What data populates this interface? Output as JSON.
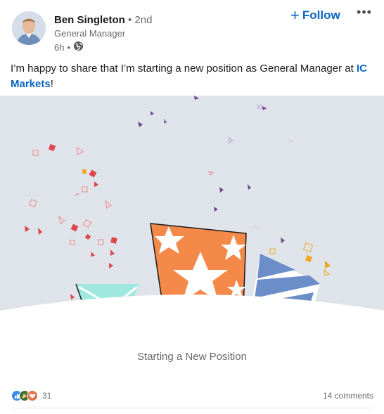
{
  "author": {
    "name": "Ben Singleton",
    "degree": "• 2nd",
    "headline": "General Manager",
    "time": "6h",
    "visibility_icon": "globe-icon"
  },
  "actions": {
    "follow_label": "Follow",
    "more_icon": "more-icon"
  },
  "post": {
    "text_before": "I’m happy to share that I’m starting a new position as General Manager at ",
    "company": "IC Markets",
    "text_after": "!"
  },
  "card": {
    "caption": "Starting a New Position"
  },
  "social": {
    "reaction_count": "31",
    "comments": "14 comments",
    "reaction_icons": [
      "like-icon",
      "celebrate-icon",
      "love-icon"
    ]
  },
  "colors": {
    "brand_blue": "#0a66c2",
    "art_background": "#dfe3ea",
    "orange": "#f5894a",
    "teal": "#9fe8df",
    "blue_stripes": "#6b8ec9"
  }
}
